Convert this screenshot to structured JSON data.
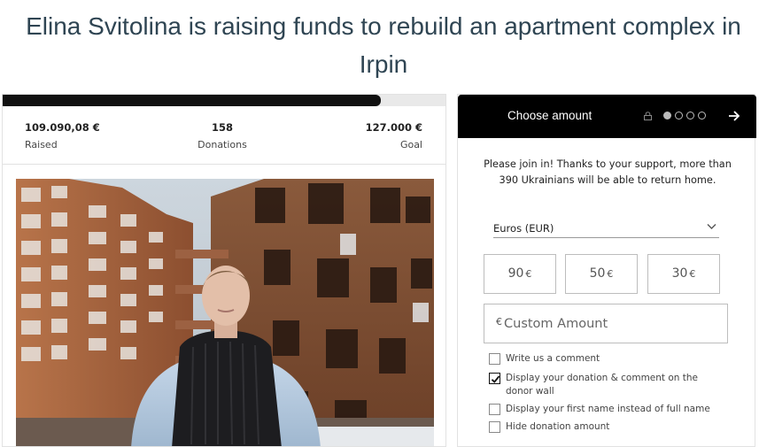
{
  "page": {
    "title": "Elina Svitolina is raising funds to rebuild an apartment complex in Irpin"
  },
  "campaign": {
    "progress": 0.85,
    "raised_value": "109.090,08 €",
    "raised_label": "Raised",
    "donations_value": "158",
    "donations_label": "Donations",
    "goal_value": "127.000 €",
    "goal_label": "Goal",
    "photo_icon": "photo-woman-in-front-of-damaged-building"
  },
  "donate": {
    "header_title": "Choose amount",
    "step_current": 1,
    "step_total": 4,
    "intro": "Please join in! Thanks to your support, more than 390 Ukrainians will be able to return home.",
    "currency": "Euros (EUR)",
    "amounts": [
      {
        "value": "90",
        "currency": "€"
      },
      {
        "value": "50",
        "currency": "€"
      },
      {
        "value": "30",
        "currency": "€"
      }
    ],
    "custom_symbol": "€",
    "custom_placeholder": "Custom Amount",
    "options": [
      {
        "label": "Write us a comment",
        "checked": false
      },
      {
        "label": "Display your donation & comment on the donor wall",
        "checked": true
      },
      {
        "label": "Display your first name instead of full name",
        "checked": false
      },
      {
        "label": "Hide donation amount",
        "checked": false
      }
    ]
  },
  "colors": {
    "title": "#2f4553",
    "header_bg": "#000000",
    "progress_fill": "#111111"
  }
}
